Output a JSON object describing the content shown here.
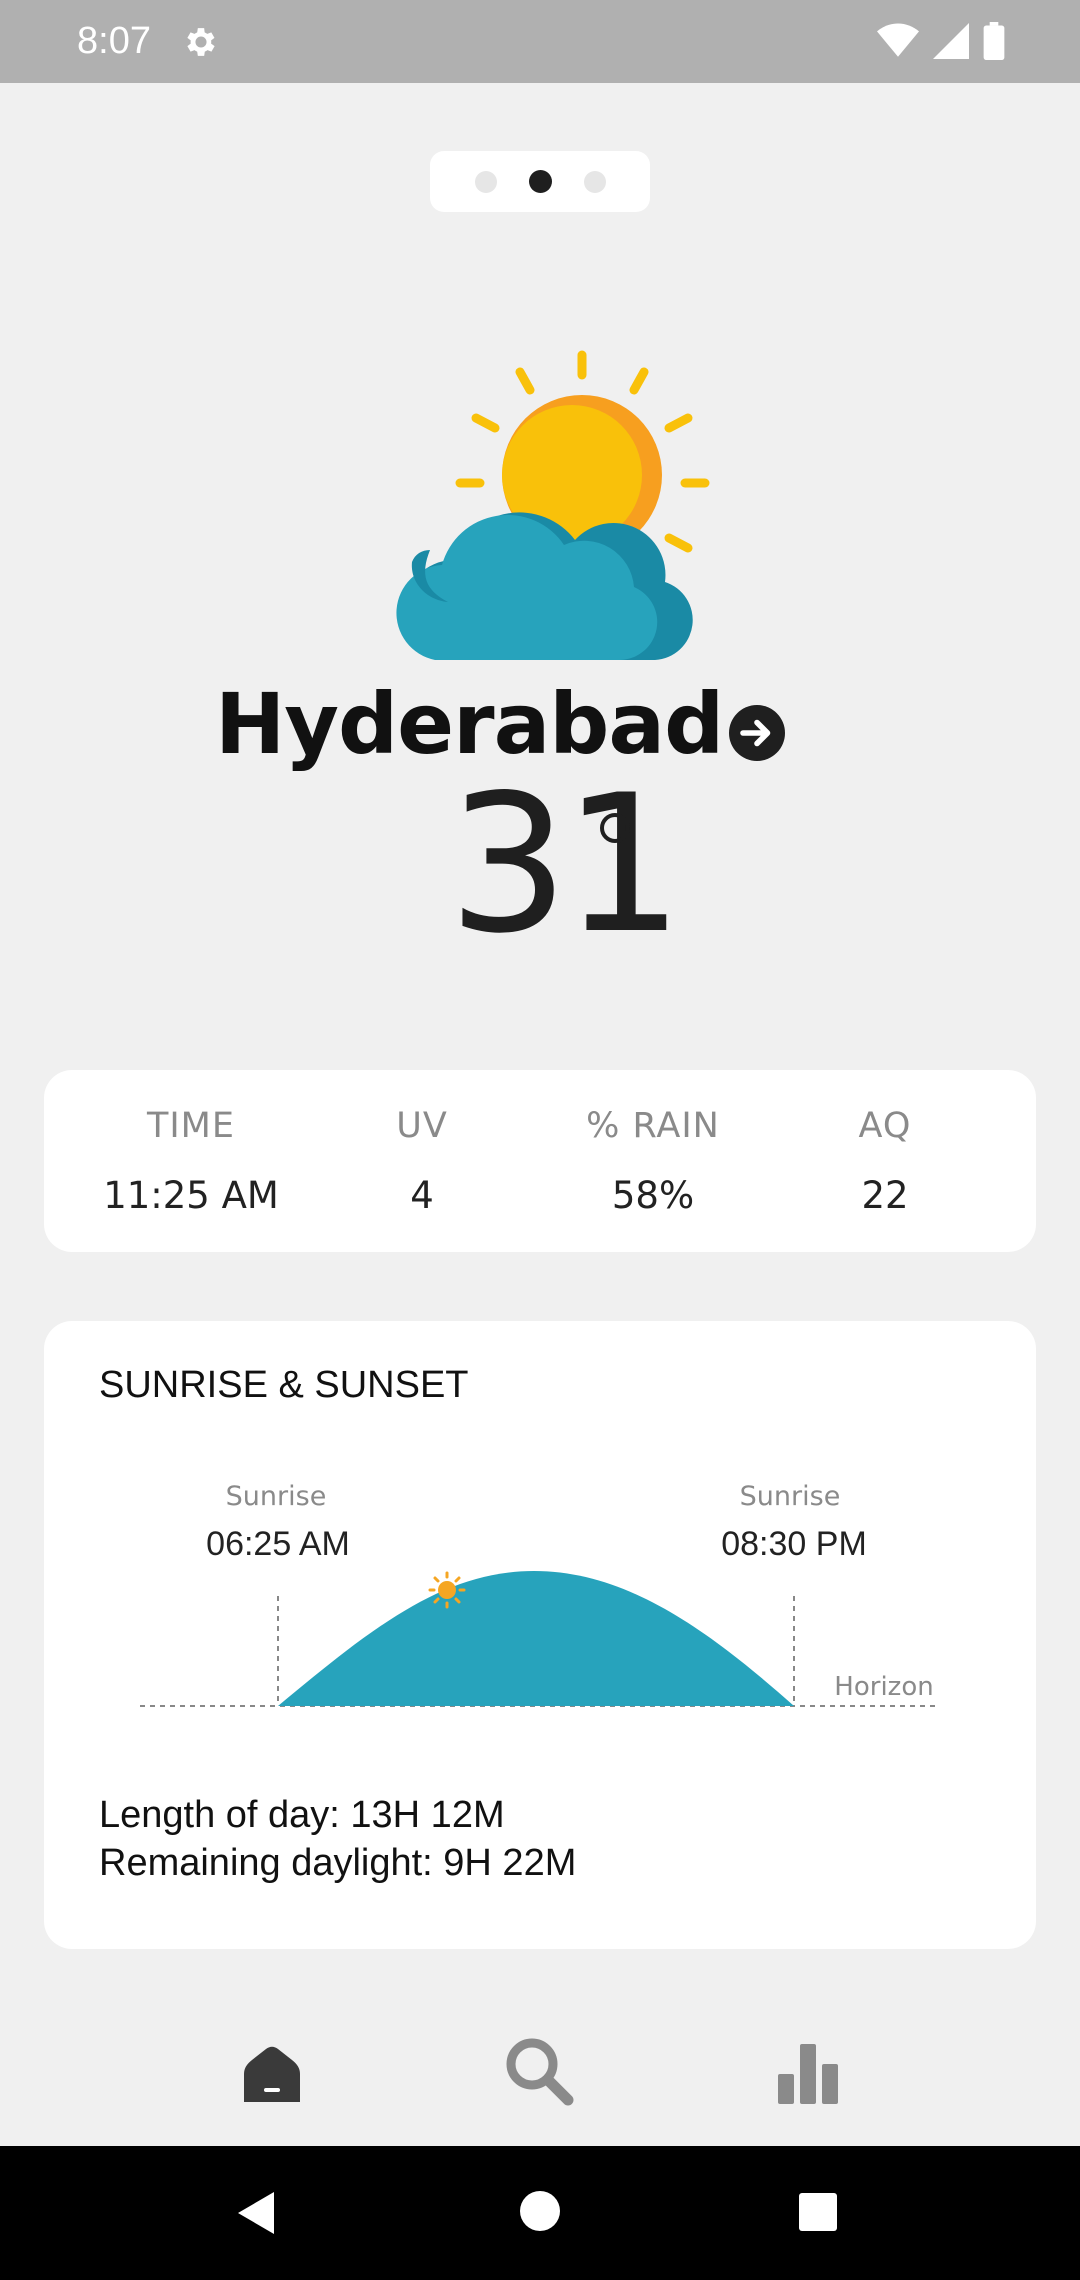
{
  "status_bar": {
    "time": "8:07",
    "icons": [
      "gear-icon",
      "wifi-icon",
      "signal-icon",
      "battery-icon"
    ]
  },
  "pager": {
    "count": 3,
    "active_index": 1
  },
  "weather": {
    "icon": "sun-behind-cloud-icon",
    "city": "Hyderabad",
    "temperature": "31"
  },
  "stats": [
    {
      "label": "TIME",
      "value": "11:25 AM"
    },
    {
      "label": "UV",
      "value": "4"
    },
    {
      "label": "% RAIN",
      "value": "58%"
    },
    {
      "label": "AQ",
      "value": "22"
    }
  ],
  "sun": {
    "title": "SUNRISE & SUNSET",
    "sunrise_label": "Sunrise",
    "sunrise_time": "06:25 AM",
    "sunset_label": "Sunrise",
    "sunset_time": "08:30 PM",
    "horizon_label": "Horizon",
    "day_length": "Length of day: 13H 12M",
    "remaining_daylight": "Remaining daylight: 9H 22M",
    "colors": {
      "arc": "#27a3bc",
      "sun": "#f5a623"
    }
  },
  "bottom_nav": {
    "items": [
      "home-icon",
      "search-icon",
      "chart-icon"
    ],
    "active_index": 0
  },
  "system_nav": [
    "back-icon",
    "home-circle-icon",
    "recents-icon"
  ]
}
